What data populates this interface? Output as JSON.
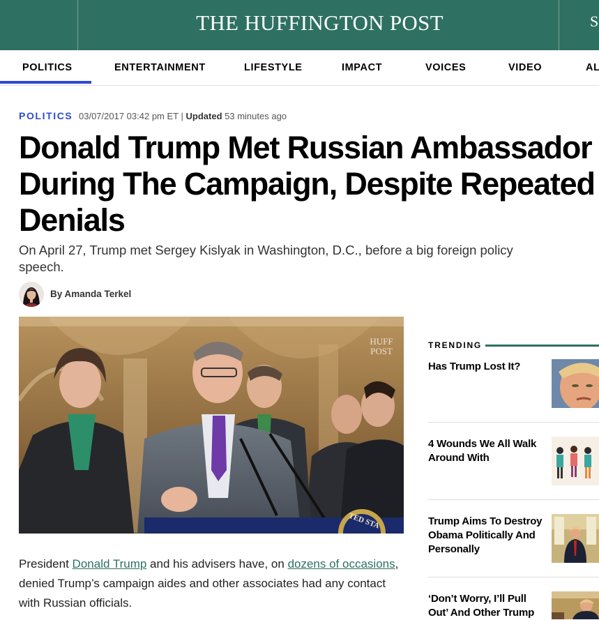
{
  "header": {
    "logo": "THE HUFFINGTON POST",
    "edge_fragment": "S"
  },
  "nav": {
    "items": [
      "POLITICS",
      "ENTERTAINMENT",
      "LIFESTYLE",
      "IMPACT",
      "VOICES",
      "VIDEO",
      "AL"
    ],
    "active": "POLITICS"
  },
  "article": {
    "section": "POLITICS",
    "date": "03/07/2017 03:42 pm ET",
    "separator": "|",
    "updated_label": "Updated",
    "updated_ago": "53 minutes ago",
    "headline": "Donald Trump Met Russian Ambassador During The Campaign, Despite Repeated Denials",
    "dek": "On April 27, Trump met Sergey Kislyak in Washington, D.C., before a big foreign policy speech.",
    "byline": "By Amanda Terkel",
    "photo_watermark": [
      "HUFF",
      "POST"
    ],
    "podium_seal_text": "TED STA",
    "body": {
      "p1_a": "President ",
      "p1_link1": "Donald Trump",
      "p1_b": " and his advisers have, on ",
      "p1_link2": "dozens of occasions",
      "p1_c": ", denied Trump’s campaign aides and other associates had any contact with Russian officials."
    }
  },
  "trending": {
    "label": "TRENDING",
    "items": [
      {
        "title": "Has Trump Lost It?"
      },
      {
        "title": "4 Wounds We All Walk Around With"
      },
      {
        "title": "Trump Aims To Destroy Obama Politically And Personally"
      },
      {
        "title": "‘Don’t Worry, I’ll Pull Out’ And Other Trump"
      }
    ]
  },
  "colors": {
    "brand_green": "#2e7061",
    "accent_blue": "#2c4bd0",
    "link_green": "#2e7061"
  }
}
